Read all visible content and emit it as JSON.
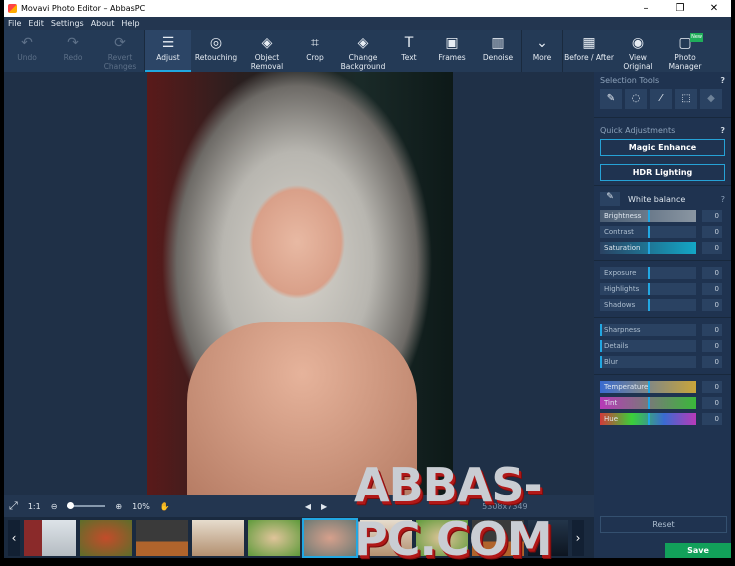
{
  "window": {
    "title": "Movavi Photo Editor – AbbasPC",
    "controls": [
      "–",
      "❐",
      "✕"
    ]
  },
  "menu": [
    "File",
    "Edit",
    "Settings",
    "About",
    "Help"
  ],
  "toolbar": {
    "items": [
      {
        "label": "Undo",
        "icon": "↶",
        "disabled": true
      },
      {
        "label": "Redo",
        "icon": "↷",
        "disabled": true
      },
      {
        "label": "Revert Changes",
        "icon": "⟳",
        "disabled": true
      },
      {
        "label": "Adjust",
        "icon": "☰",
        "active": true
      },
      {
        "label": "Retouching",
        "icon": "◎"
      },
      {
        "label": "Object Removal",
        "icon": "◈"
      },
      {
        "label": "Crop",
        "icon": "⌗"
      },
      {
        "label": "Change Background",
        "icon": "◈"
      },
      {
        "label": "Text",
        "icon": "T"
      },
      {
        "label": "Frames",
        "icon": "▣"
      },
      {
        "label": "Denoise",
        "icon": "▥"
      },
      {
        "label": "More",
        "icon": "⌄"
      },
      {
        "label": "Before / After",
        "icon": "▦"
      },
      {
        "label": "View Original",
        "icon": "◉"
      },
      {
        "label": "Photo Manager",
        "icon": "▢",
        "badge": "New"
      }
    ]
  },
  "panel": {
    "selection_tools": "Selection Tools",
    "help": "?",
    "quick_adjustments": "Quick Adjustments",
    "magic_enhance": "Magic Enhance",
    "hdr_lighting": "HDR Lighting",
    "white_balance": "White balance",
    "groups": [
      [
        {
          "label": "Brightness",
          "value": "0"
        },
        {
          "label": "Contrast",
          "value": "0"
        },
        {
          "label": "Saturation",
          "value": "0"
        }
      ],
      [
        {
          "label": "Exposure",
          "value": "0"
        },
        {
          "label": "Highlights",
          "value": "0"
        },
        {
          "label": "Shadows",
          "value": "0"
        }
      ],
      [
        {
          "label": "Sharpness",
          "value": "0"
        },
        {
          "label": "Details",
          "value": "0"
        },
        {
          "label": "Blur",
          "value": "0"
        }
      ],
      [
        {
          "label": "Temperature",
          "value": "0"
        },
        {
          "label": "Tint",
          "value": "0"
        },
        {
          "label": "Hue",
          "value": "0"
        }
      ]
    ],
    "reset": "Reset",
    "save": "Save"
  },
  "bottom": {
    "fit": "⤢",
    "one_to_one": "1:1",
    "zoom": "10%",
    "dimensions": "5308x7349"
  },
  "watermark": "ABBAS-PC.COM"
}
